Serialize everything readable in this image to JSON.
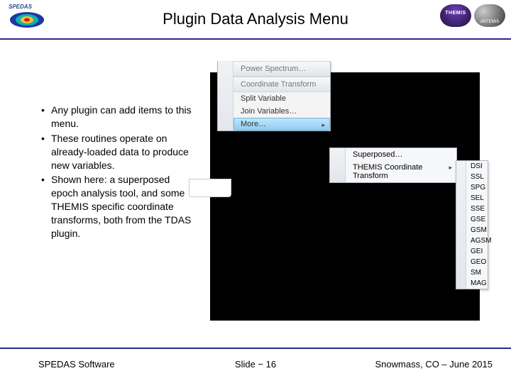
{
  "header": {
    "title": "Plugin Data Analysis Menu",
    "badges": {
      "themis": "THEMIS",
      "artemis": "ARTEMIS"
    }
  },
  "bullets": [
    "Any plugin can add items to this menu.",
    "These routines operate on already-loaded data to produce new variables.",
    "Shown here: a superposed epoch analysis tool, and some THEMIS specific coordinate transforms, both from the TDAS plugin."
  ],
  "menu": {
    "group_top": "Power Spectrum…",
    "group_transform": "Coordinate Transform",
    "items": {
      "split": "Split Variable",
      "join": "Join Variables…",
      "more": "More…"
    },
    "flyout": {
      "superposed": "Superposed…",
      "themis_ct": "THEMIS Coordinate Transform"
    },
    "coords": [
      "DSI",
      "SSL",
      "SPG",
      "SEL",
      "SSE",
      "GSE",
      "GSM",
      "AGSM",
      "GEI",
      "GEO",
      "SM",
      "MAG"
    ]
  },
  "footer": {
    "left": "SPEDAS Software",
    "center": "Slide − 16",
    "right": "Snowmass, CO – June 2015"
  }
}
